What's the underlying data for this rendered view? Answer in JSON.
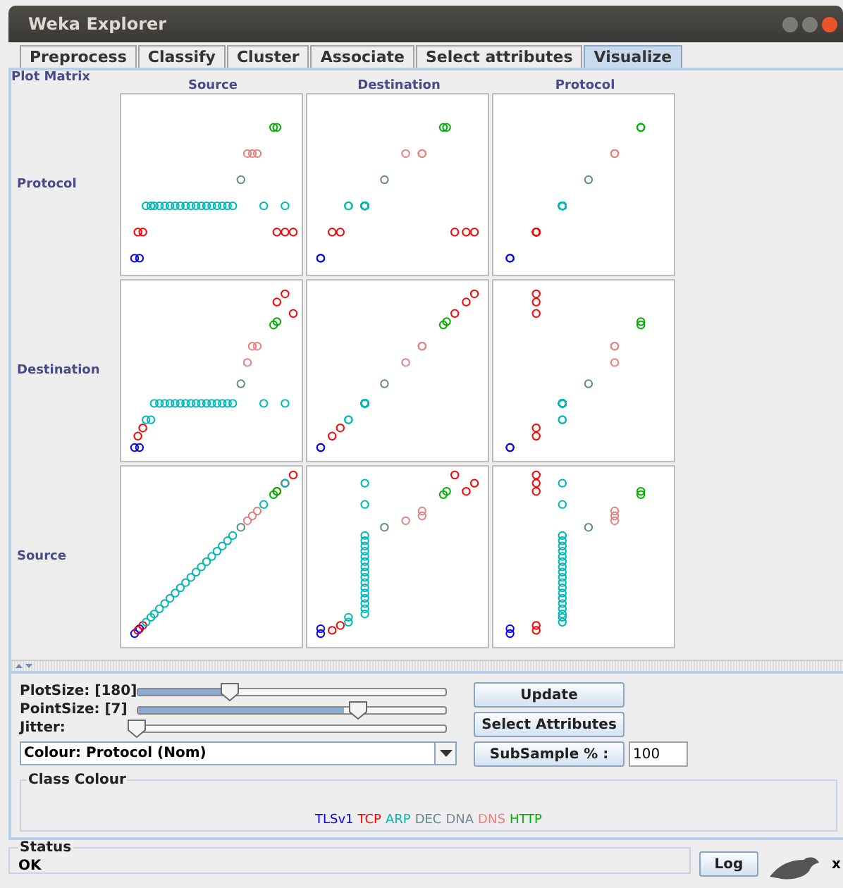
{
  "window": {
    "title": "Weka Explorer"
  },
  "tabs": [
    {
      "label": "Preprocess",
      "selected": false
    },
    {
      "label": "Classify",
      "selected": false
    },
    {
      "label": "Cluster",
      "selected": false
    },
    {
      "label": "Associate",
      "selected": false
    },
    {
      "label": "Select attributes",
      "selected": false
    },
    {
      "label": "Visualize",
      "selected": true
    }
  ],
  "plot_matrix": {
    "title": "Plot Matrix",
    "columns": [
      "Source",
      "Destination",
      "Protocol"
    ],
    "rows": [
      "Protocol",
      "Destination",
      "Source"
    ]
  },
  "controls": {
    "sliders": [
      {
        "label": "PlotSize: [180]",
        "level": 0.28
      },
      {
        "label": "PointSize: [7]",
        "level": 0.67
      },
      {
        "label": "Jitter:",
        "level": 0
      }
    ],
    "colour": {
      "value": "Colour: Protocol (Nom)"
    },
    "buttons": [
      "Update",
      "Select Attributes"
    ],
    "subsample": {
      "label": "SubSample % :",
      "value": "100"
    }
  },
  "class_colour": {
    "title": "Class Colour",
    "classes": [
      {
        "name": "TLSv1",
        "color": "#0000ff"
      },
      {
        "name": "TCP",
        "color": "#ff0000"
      },
      {
        "name": "ARP",
        "color": "#00b8b8"
      },
      {
        "name": "DEC",
        "color": "#5f8a8a"
      },
      {
        "name": "DNA",
        "color": "#778899"
      },
      {
        "name": "DNS",
        "color": "#e88080"
      },
      {
        "name": "HTTP",
        "color": "#00b000"
      }
    ]
  },
  "status": {
    "title": "Status",
    "message": "OK"
  },
  "log_button": "Log",
  "counter": "x"
}
